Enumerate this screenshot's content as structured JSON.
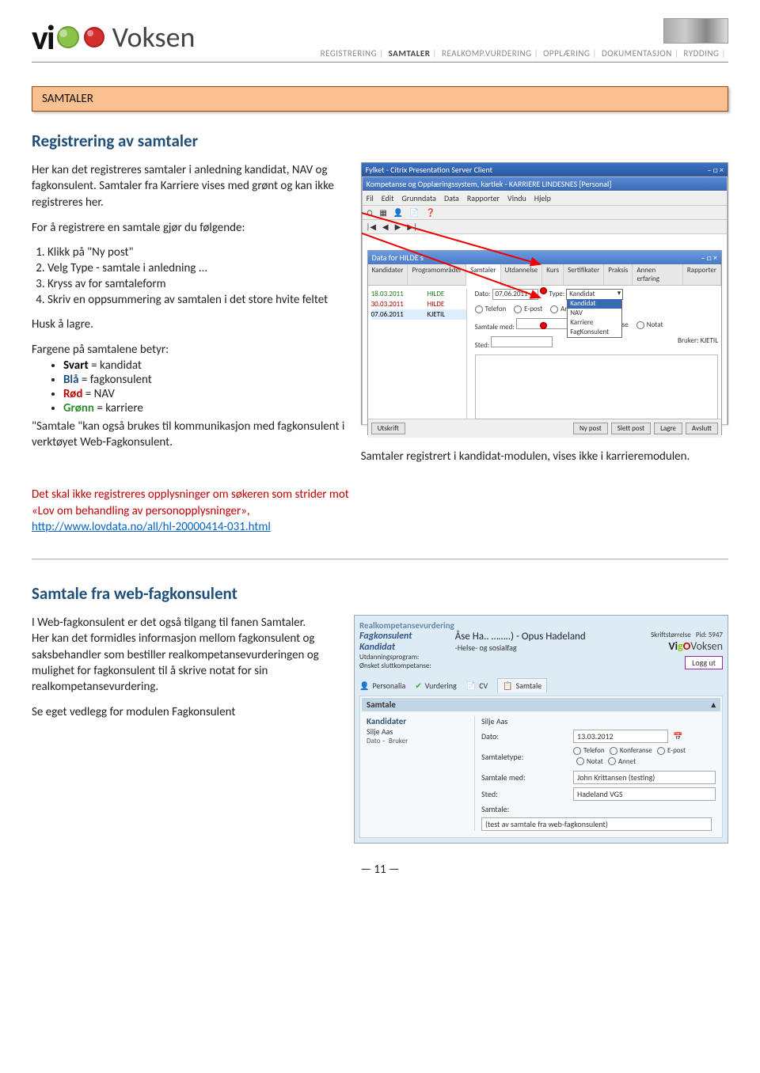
{
  "breadcrumb": {
    "items": [
      "REGISTRERING",
      "SAMTALER",
      "REALKOMP.VURDERING",
      "OPPLÆRING",
      "DOKUMENTASJON",
      "RYDDING"
    ],
    "active_index": 1
  },
  "logo": {
    "vi": "vi",
    "o_letter": "o",
    "voksen": "Voksen"
  },
  "banner": {
    "title": "SAMTALER"
  },
  "section1": {
    "heading": "Registrering av samtaler",
    "p1": "Her kan det registreres samtaler i anledning kandidat, NAV og fagkonsulent. Samtaler fra Karriere vises med grønt og kan ikke registreres her.",
    "steps_intro": "For å registrere en samtale gjør du følgende:",
    "steps": [
      "Klikk på \"Ny post\"",
      "Velg Type -  samtale i anledning ...",
      "Kryss av for samtaleform",
      "Skriv en oppsummering av samtalen i det store hvite feltet"
    ],
    "steps_after": "Husk å lagre.",
    "colors_intro": "Fargene på samtalene betyr:",
    "colors": {
      "svart": "Svart",
      "svart_eq": " = kandidat",
      "bla": "Blå",
      "bla_eq": " = fagkonsulent",
      "rod": "Rød",
      "rod_eq": " = NAV",
      "gronn": "Grønn",
      "gronn_eq": " = karriere"
    },
    "p_after_colors": "\"Samtale \"kan også brukes til kommunikasjon med fagkonsulent i verktøyet Web-Fagkonsulent.",
    "caption": "Samtaler registrert i kandidat-modulen, vises ikke i karrieremodulen.",
    "warning_pre": "Det skal ikke registreres opplysninger om søkeren som strider mot «Lov om behandling av personopplysninger», ",
    "warning_link": "http://www.lovdata.no/all/hl-20000414-031.html"
  },
  "screenshot1": {
    "window_title": "Fylket - Citrix Presentation Server Client",
    "subwindow_title": "Kompetanse og Opplæringssystem, kartlek - KARRIERE LINDESNES [Personal]",
    "menu": [
      "Fil",
      "Edit",
      "Grunndata",
      "Data",
      "Rapporter",
      "Vindu",
      "Hjelp"
    ],
    "data_for": "Data for HILDE s",
    "tabs": [
      "Kandidater",
      "Programområder",
      "Samtaler",
      "Utdannelse",
      "Kurs",
      "Sertifikater",
      "Praksis",
      "Annen erfaring",
      "Rapporter"
    ],
    "active_tab": 2,
    "rows": [
      {
        "date": "18.03.2011",
        "name": "HILDE"
      },
      {
        "date": "30.03.2011",
        "name": "HILDE"
      },
      {
        "date": "07.06.2011",
        "name": "KJETIL"
      }
    ],
    "form": {
      "dato_lbl": "Dato:",
      "dato_val": "07.06.2011",
      "samtale_med_lbl": "Samtale med:",
      "sted_lbl": "Sted:",
      "type_lbl": "Type:",
      "type_val": "Kandidat",
      "type_options": [
        "Kandidat",
        "NAV",
        "Karriere",
        "FagKonsulent"
      ],
      "cb_telefon": "Telefon",
      "cb_konferanse": "Konferanse",
      "cb_epost": "E-post",
      "cb_notat": "Notat",
      "cb_annet": "Annet",
      "bruker_lbl": "Bruker:",
      "bruker_val": "KJETIL"
    },
    "left_btn": "Utskrift",
    "buttons": [
      "Ny post",
      "Slett post",
      "Lagre",
      "Avslutt"
    ]
  },
  "section2": {
    "heading": "Samtale fra web-fagkonsulent",
    "p1": "I Web-fagkonsulent er det også tilgang til fanen Samtaler.",
    "p2": "Her kan det formidles informasjon mellom fagkonsulent og saksbehandler som bestiller realkompetansevurderingen og mulighet for fagkonsulent til å skrive notat for sin realkompetansevurdering.",
    "p3": "Se eget vedlegg for modulen Fagkonsulent"
  },
  "screenshot2": {
    "panel_title": "Realkompetansevurdering",
    "left": {
      "l1": "Fagkonsulent",
      "l2": "Kandidat",
      "l3": "Utdanningsprogram:",
      "l4": "Ønsket sluttkompetanse:"
    },
    "mid": {
      "name": "Åse Ha.. ……..) - Opus Hadeland",
      "utd": "-Helse- og sosialfag",
      "skrift": "Skriftstørrelse"
    },
    "right": {
      "pid": "Pid: 5947",
      "logo": "Vi",
      "logo_g": "g",
      "logo_o": "O",
      "logo_v": "Voksen",
      "logg_ut": "Logg ut"
    },
    "tabs": [
      "Personalia",
      "Vurdering",
      "CV",
      "Samtale"
    ],
    "active": 3,
    "panel_head": "Samtale",
    "kandidater": "Kandidater",
    "rows": {
      "silje": "Silje Aas",
      "dato_lbl": "Dato –",
      "bruker": "Bruker",
      "samtale_med_lbl": "Samtale med:",
      "dato_val_lbl": "Dato:",
      "dato_val": "13.03.2012",
      "samtaletype_lbl": "Samtaletype:",
      "cb": [
        "Telefon",
        "Konferanse",
        "E-post",
        "Notat",
        "Annet"
      ],
      "samtale_med_val": "John Krittansen (testing)",
      "sted_lbl": "Sted:",
      "sted_val": "Hadeland VGS",
      "samtale_lbl": "Samtale:",
      "samtale_val": "(test av samtale fra web-fagkonsulent)"
    }
  },
  "footer": {
    "page": "— 11 —"
  }
}
